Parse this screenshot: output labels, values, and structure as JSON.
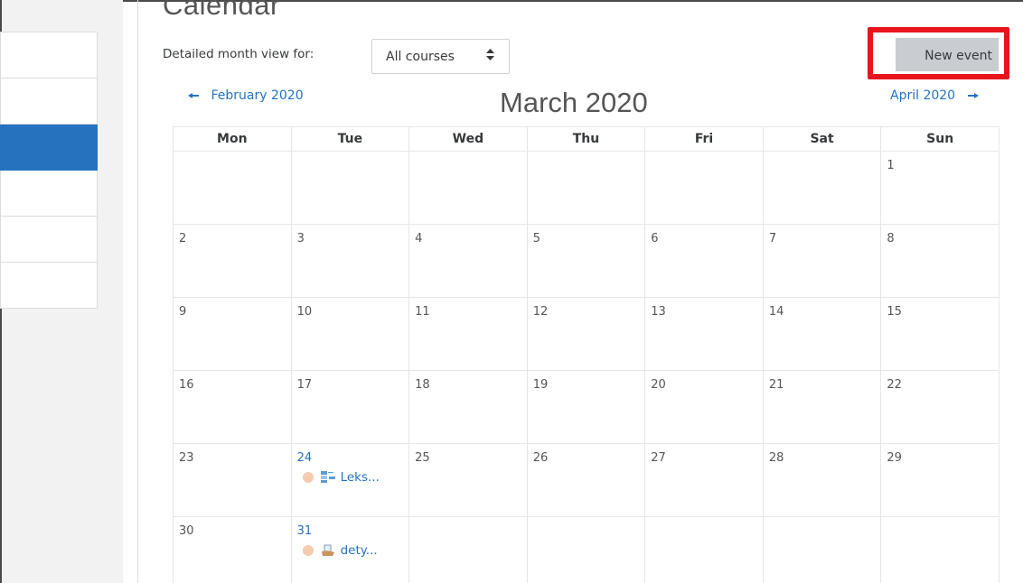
{
  "page": {
    "title": "Calendar",
    "filter_label": "Detailed month view for:",
    "course_select_value": "All courses",
    "select_arrow": "⬍",
    "new_event_label": "New event"
  },
  "navigation": {
    "prev_label": "February 2020",
    "next_label": "April 2020",
    "current_month": "March 2020",
    "prev_arrow": "◄",
    "next_arrow": "►"
  },
  "sidebar": {
    "items": [
      {
        "label": "",
        "active": false
      },
      {
        "label": "",
        "active": false
      },
      {
        "label": "",
        "active": true
      },
      {
        "label": "",
        "active": false
      },
      {
        "label": "",
        "active": false
      },
      {
        "label": "",
        "active": false
      }
    ]
  },
  "calendar": {
    "weekdays": [
      "Mon",
      "Tue",
      "Wed",
      "Thu",
      "Fri",
      "Sat",
      "Sun"
    ],
    "weeks": [
      [
        "",
        "",
        "",
        "",
        "",
        "",
        "1"
      ],
      [
        "2",
        "3",
        "4",
        "5",
        "6",
        "7",
        "8"
      ],
      [
        "9",
        "10",
        "11",
        "12",
        "13",
        "14",
        "15"
      ],
      [
        "16",
        "17",
        "18",
        "19",
        "20",
        "21",
        "22"
      ],
      [
        "23",
        "24",
        "25",
        "26",
        "27",
        "28",
        "29"
      ],
      [
        "30",
        "31",
        "",
        "",
        "",
        "",
        ""
      ]
    ],
    "events": {
      "24": {
        "label": "Leks...",
        "icon": "lesson-icon"
      },
      "31": {
        "label": "dety...",
        "icon": "assignment-icon"
      }
    }
  },
  "colors": {
    "accent": "#2672bf",
    "highlight": "#e8141c",
    "button_bg": "#c9ccd1",
    "event_dot": "#f5cbb0"
  }
}
